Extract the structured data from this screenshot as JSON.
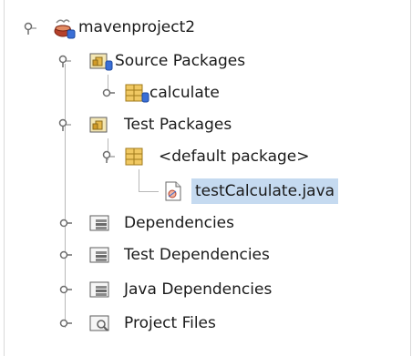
{
  "tree": {
    "root": {
      "label": "mavenproject2",
      "expanded": true,
      "icon": "maven-project-icon"
    },
    "items": [
      {
        "label": "Source Packages",
        "expanded": true,
        "icon": "source-packages-icon"
      },
      {
        "label": "calculate",
        "expanded": false,
        "icon": "package-icon"
      },
      {
        "label": "Test Packages",
        "expanded": true,
        "icon": "test-packages-icon"
      },
      {
        "label": "<default package>",
        "expanded": true,
        "icon": "package-icon"
      },
      {
        "label": "testCalculate.java",
        "selected": true,
        "icon": "java-file-icon"
      },
      {
        "label": "Dependencies",
        "expanded": false,
        "icon": "library-icon"
      },
      {
        "label": "Test Dependencies",
        "expanded": false,
        "icon": "library-icon"
      },
      {
        "label": "Java Dependencies",
        "expanded": false,
        "icon": "library-icon"
      },
      {
        "label": "Project Files",
        "expanded": false,
        "icon": "project-files-icon"
      }
    ]
  },
  "colors": {
    "selection": "#c5daf0",
    "folder": "#e6b84a",
    "guide": "#b8b8b8",
    "badge": "#3a6fd6"
  }
}
